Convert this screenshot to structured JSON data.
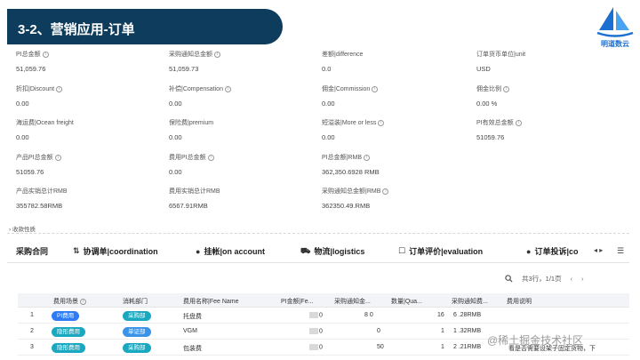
{
  "title": "3-2、营销应用-订单",
  "logo": {
    "text": "明道数云"
  },
  "fields": [
    {
      "label": "PI总金额",
      "value": "51,059.76"
    },
    {
      "label": "采购通知总金额",
      "value": "51,059.73"
    },
    {
      "label": "差额|difference",
      "value": "0.0"
    },
    {
      "label": "订单货币单位|unit",
      "value": "USD"
    },
    {
      "label": "折扣|Discount",
      "value": "0.00"
    },
    {
      "label": "补偿|Compensation",
      "value": "0.00"
    },
    {
      "label": "佣金|Commission",
      "value": "0.00"
    },
    {
      "label": "佣金比例",
      "value": "0.00 %"
    },
    {
      "label": "海运费|Ocean freight",
      "value": "0.00"
    },
    {
      "label": "保险费|premium",
      "value": "0.00"
    },
    {
      "label": "短溢装|More or less",
      "value": "0.00"
    },
    {
      "label": "PI有效总金额",
      "value": "51059.76"
    },
    {
      "label": "产品PI总金额",
      "value": "51059.76"
    },
    {
      "label": "费用PI总金额",
      "value": "0.00"
    },
    {
      "label": "PI总金额|RMB",
      "value": "362,350.6928 RMB"
    },
    {
      "label": "产品实销总计RMB",
      "value": "355782.58RMB"
    },
    {
      "label": "费用实销总计RMB",
      "value": "6567.91RMB"
    },
    {
      "label": "采购通知总金额|RMB",
      "value": "362350.49.RMB"
    }
  ],
  "collapse_label": "收款性质",
  "tabs": [
    {
      "label": "采购合同",
      "icon": ""
    },
    {
      "label": "协调单|coordination",
      "icon": "⇅"
    },
    {
      "label": "挂帐|on account",
      "icon": "●"
    },
    {
      "label": "物流|logistics",
      "icon": "⛟"
    },
    {
      "label": "订单评价|evaluation",
      "icon": "☐"
    },
    {
      "label": "订单投诉|co",
      "icon": "●"
    }
  ],
  "tab_nav": {
    "arrows": "◂ ▸",
    "menu": "☰"
  },
  "pager": {
    "text": "共3行，1/1页",
    "prev": "‹",
    "next": "›"
  },
  "table": {
    "headers": [
      "",
      "费用场景",
      "消耗部门",
      "费用名称|Fee Name",
      "PI金额|Fe...",
      "采购通知金...",
      "数量|Qua...",
      "采购通知费...",
      "费用说明"
    ],
    "rows": [
      {
        "no": "1",
        "scene": "PI费用",
        "dept": "采购部",
        "name": "托盘费",
        "pi": "0",
        "notice": "8    0",
        "qty": "16",
        "fee": "6   .28RMB",
        "desc": ""
      },
      {
        "no": "2",
        "scene": "隐形费用",
        "dept": "单证部",
        "name": "VGM",
        "pi": "0",
        "notice": "0",
        "qty": "1",
        "fee": "1   .32RMB",
        "desc": ""
      },
      {
        "no": "3",
        "scene": "隐形费用",
        "dept": "采购部",
        "name": "包装费",
        "pi": "0",
        "notice": "50",
        "qty": "1",
        "fee": "2   .21RMB",
        "desc": "看是否需要设架子固定货物，下"
      }
    ]
  },
  "watermark": "@稀土掘金技术社区",
  "colors": {
    "title_bg": "#0e3c5c",
    "logo": "#1a6fd1",
    "pill_blue": "#2f7bf5",
    "pill_teal": "#1aa8c0"
  }
}
